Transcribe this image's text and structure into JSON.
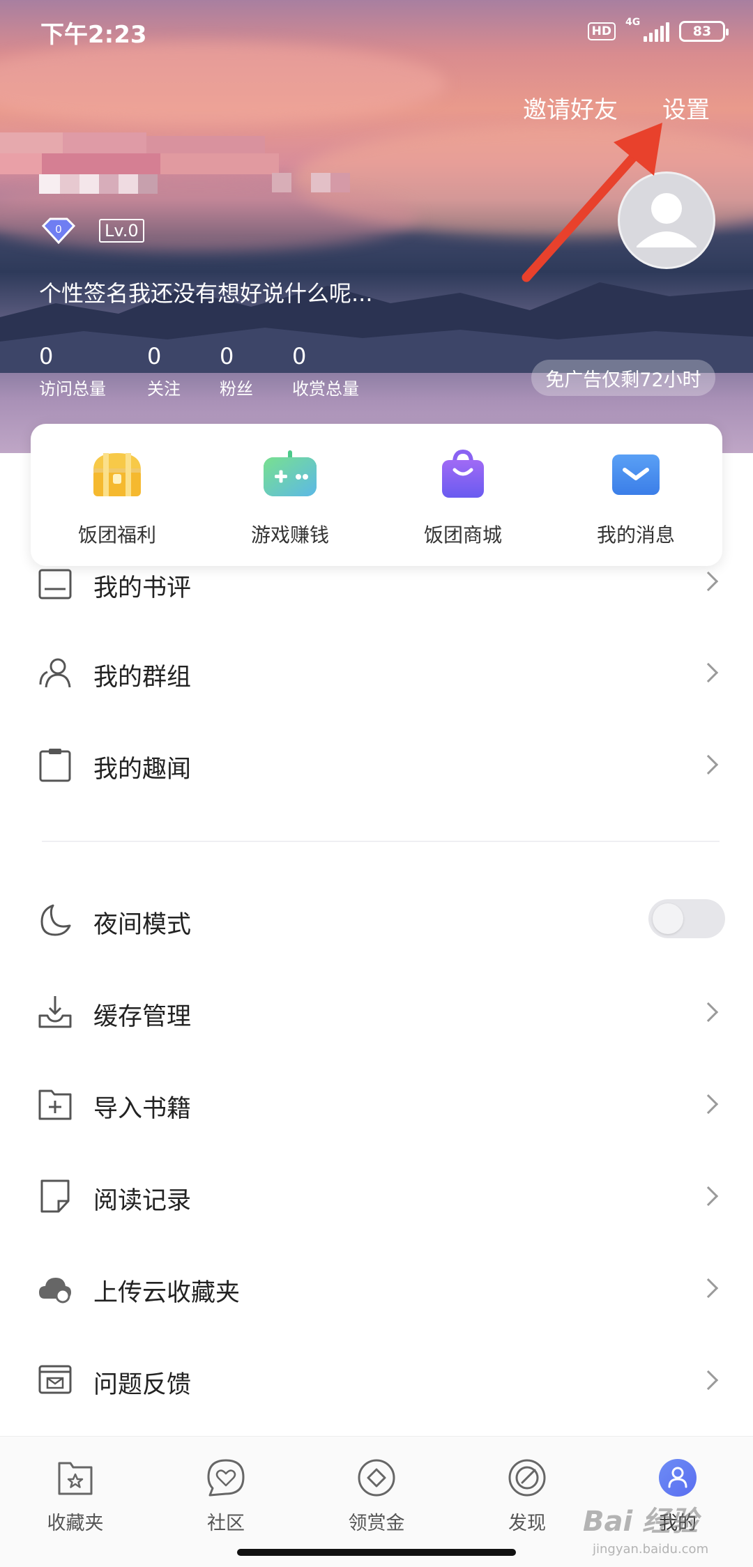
{
  "status_bar": {
    "time": "下午2:23",
    "hd": "HD",
    "network": "4G",
    "battery": "83"
  },
  "header": {
    "invite_label": "邀请好友",
    "settings_label": "设置",
    "level": "Lv.0",
    "vip_level": "0",
    "signature": "个性签名我还没有想好说什么呢...",
    "stats": [
      {
        "value": "0",
        "label": "访问总量"
      },
      {
        "value": "0",
        "label": "关注"
      },
      {
        "value": "0",
        "label": "粉丝"
      },
      {
        "value": "0",
        "label": "收赏总量"
      }
    ],
    "ad_free": "免广告仅剩72小时"
  },
  "quick_actions": [
    {
      "label": "饭团福利",
      "icon": "treasure-chest-icon",
      "color": "#f5c542"
    },
    {
      "label": "游戏赚钱",
      "icon": "gamepad-icon",
      "color": "#5fd39a"
    },
    {
      "label": "饭团商城",
      "icon": "shopping-bag-icon",
      "color": "#8a63f2"
    },
    {
      "label": "我的消息",
      "icon": "mail-icon",
      "color": "#4a8ff0"
    }
  ],
  "menu": {
    "book_review": "我的书评",
    "groups": "我的群组",
    "news": "我的趣闻",
    "night_mode": "夜间模式",
    "cache": "缓存管理",
    "import_books": "导入书籍",
    "reading_history": "阅读记录",
    "upload_cloud": "上传云收藏夹",
    "feedback": "问题反馈"
  },
  "bottom_nav": [
    {
      "label": "收藏夹",
      "icon": "bookmark-folder-icon"
    },
    {
      "label": "社区",
      "icon": "heart-chat-icon"
    },
    {
      "label": "领赏金",
      "icon": "diamond-coin-icon"
    },
    {
      "label": "发现",
      "icon": "compass-icon"
    },
    {
      "label": "我的",
      "icon": "profile-icon",
      "active": true
    }
  ],
  "watermark": {
    "brand": "Bai 经验",
    "url": "jingyan.baidu.com"
  }
}
